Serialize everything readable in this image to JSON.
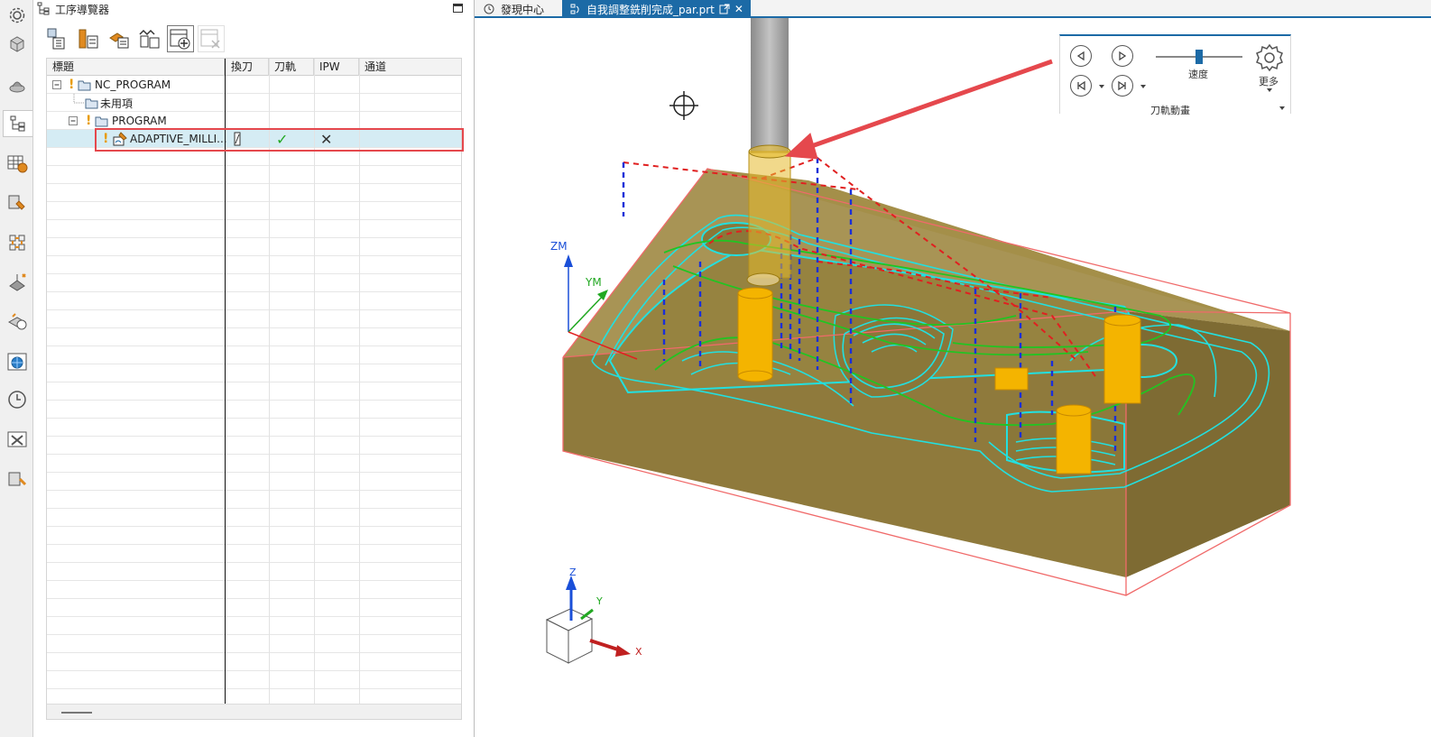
{
  "navigator": {
    "title": "工序導覽器",
    "columns": [
      "標題",
      "換刀",
      "刀軌",
      "IPW",
      "通道"
    ],
    "rows": [
      {
        "label": "NC_PROGRAM",
        "indent": 0
      },
      {
        "label": "未用項",
        "indent": 1
      },
      {
        "label": "PROGRAM",
        "indent": 1
      },
      {
        "label": "ADAPTIVE_MILLI...",
        "indent": 2,
        "toolpath": "✓",
        "ipw": "✕"
      }
    ]
  },
  "tabs": [
    {
      "label": "發現中心"
    },
    {
      "label": "自我調整銑削完成_par.prt",
      "active": true
    }
  ],
  "animation": {
    "speed_label": "速度",
    "speed_value": 0.5,
    "more_label": "更多",
    "group_label": "刀軌動畫"
  },
  "viewport": {
    "axis_zm": "ZM",
    "axis_ym": "YM",
    "triad_z": "Z",
    "triad_y": "Y",
    "triad_x": "X"
  },
  "colors": {
    "accent": "#1c6aa6",
    "highlight_box": "#e5484d",
    "toolpath_cyan": "#22e0e0",
    "toolpath_green": "#22c422",
    "rapid_red": "#e02020",
    "engage_blue": "#1a2fd8",
    "part_gold": "#8f7a3c",
    "tool_yellow": "#f4b400"
  }
}
